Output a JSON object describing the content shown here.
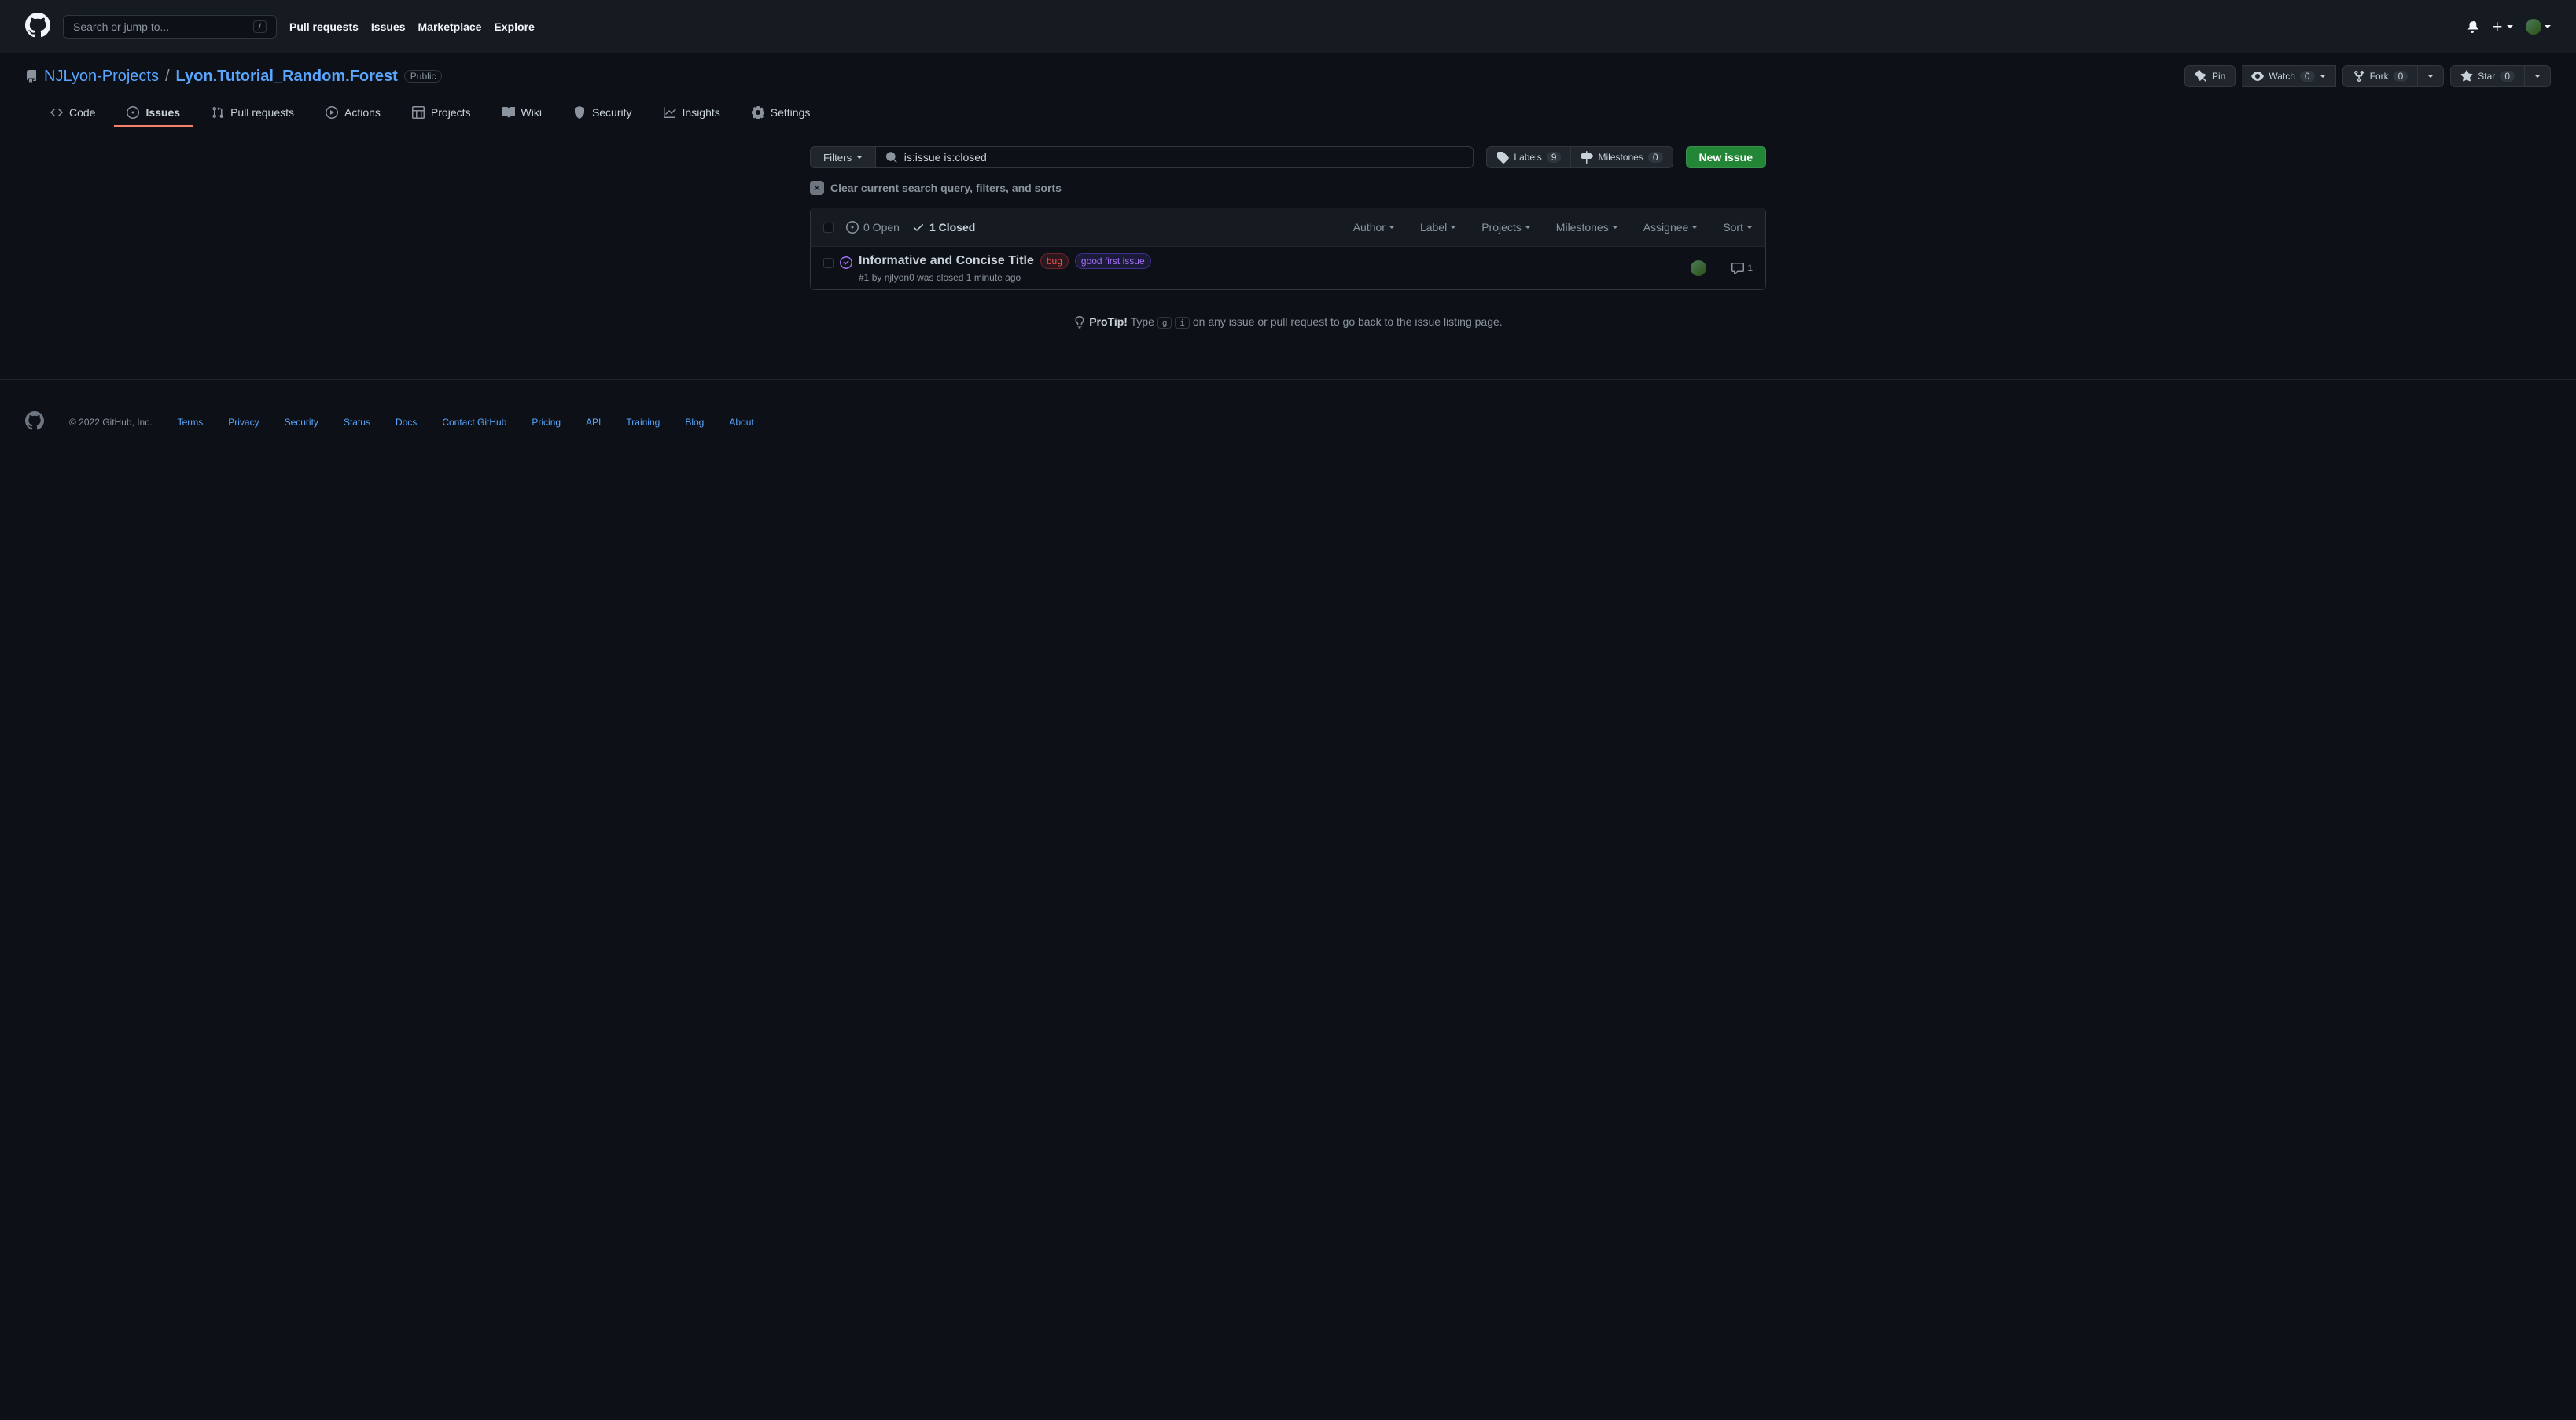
{
  "header": {
    "search_placeholder": "Search or jump to...",
    "slash": "/",
    "nav": {
      "pull_requests": "Pull requests",
      "issues": "Issues",
      "marketplace": "Marketplace",
      "explore": "Explore"
    }
  },
  "repo": {
    "owner": "NJLyon-Projects",
    "name": "Lyon.Tutorial_Random.Forest",
    "visibility": "Public",
    "actions": {
      "pin": "Pin",
      "watch": "Watch",
      "watch_count": "0",
      "fork": "Fork",
      "fork_count": "0",
      "star": "Star",
      "star_count": "0"
    }
  },
  "tabs": {
    "code": "Code",
    "issues": "Issues",
    "pulls": "Pull requests",
    "actions": "Actions",
    "projects": "Projects",
    "wiki": "Wiki",
    "security": "Security",
    "insights": "Insights",
    "settings": "Settings"
  },
  "subnav": {
    "filters": "Filters",
    "search_value": "is:issue is:closed",
    "labels": "Labels",
    "labels_count": "9",
    "milestones": "Milestones",
    "milestones_count": "0",
    "new_issue": "New issue"
  },
  "clear_text": "Clear current search query, filters, and sorts",
  "list_header": {
    "open": "0 Open",
    "closed": "1 Closed",
    "filters": {
      "author": "Author",
      "label": "Label",
      "projects": "Projects",
      "milestones": "Milestones",
      "assignee": "Assignee",
      "sort": "Sort"
    }
  },
  "issues": [
    {
      "title": "Informative and Concise Title",
      "labels": [
        "bug",
        "good first issue"
      ],
      "number": "#1",
      "by_word": "by",
      "author": "njlyon0",
      "meta_suffix": "was closed 1 minute ago",
      "comments": "1"
    }
  ],
  "protip": {
    "label": "ProTip!",
    "prefix": "Type",
    "key1": "g",
    "key2": "i",
    "suffix": "on any issue or pull request to go back to the issue listing page."
  },
  "footer": {
    "copyright": "© 2022 GitHub, Inc.",
    "links": {
      "terms": "Terms",
      "privacy": "Privacy",
      "security": "Security",
      "status": "Status",
      "docs": "Docs",
      "contact": "Contact GitHub",
      "pricing": "Pricing",
      "api": "API",
      "training": "Training",
      "blog": "Blog",
      "about": "About"
    }
  }
}
